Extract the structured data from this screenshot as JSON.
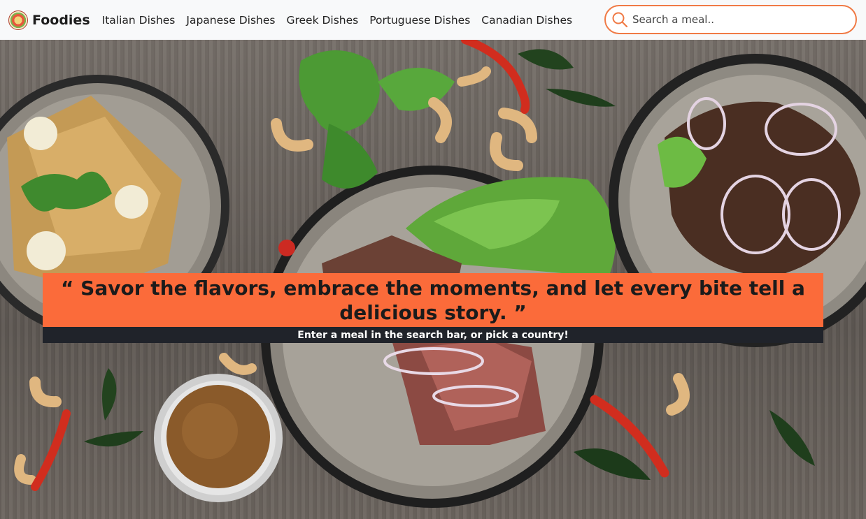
{
  "navbar": {
    "brand_name": "Foodies",
    "links": [
      {
        "label": "Italian Dishes"
      },
      {
        "label": "Japanese Dishes"
      },
      {
        "label": "Greek Dishes"
      },
      {
        "label": "Portuguese Dishes"
      },
      {
        "label": "Canadian Dishes"
      }
    ],
    "search": {
      "placeholder": "Search a meal..",
      "value": ""
    }
  },
  "hero": {
    "quote": "“ Savor the flavors, embrace the moments, and let every bite tell a delicious story. ”",
    "subtitle": "Enter a meal in the search bar, or pick a country!"
  },
  "colors": {
    "accent": "#fb6b3a",
    "search_border": "#f07a45",
    "subtitle_bg": "#20232a",
    "navbar_bg": "#f8f9fa"
  }
}
